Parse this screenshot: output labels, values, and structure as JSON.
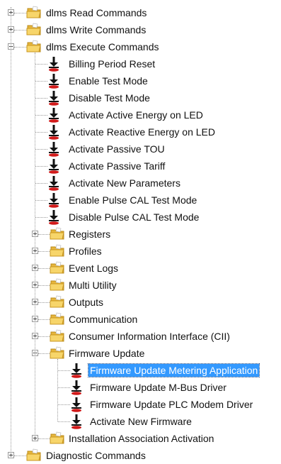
{
  "tree": {
    "top": [
      {
        "label": "dlms Read Commands",
        "state": "collapsed"
      },
      {
        "label": "dlms Write Commands",
        "state": "collapsed"
      },
      {
        "label": "dlms Execute Commands",
        "state": "expanded"
      }
    ],
    "execute_commands": [
      "Billing Period Reset",
      "Enable Test Mode",
      "Disable Test Mode",
      "Activate Active Energy on LED",
      "Activate Reactive Energy on LED",
      "Activate Passive TOU",
      "Activate Passive Tariff",
      "Activate New Parameters",
      "Enable Pulse CAL Test Mode",
      "Disable Pulse CAL Test Mode"
    ],
    "execute_folders": [
      "Registers",
      "Profiles",
      "Event Logs",
      "Multi Utility",
      "Outputs",
      "Communication",
      "Consumer Information Interface (CII)",
      "Firmware Update"
    ],
    "firmware_commands": [
      "Firmware Update Metering Application",
      "Firmware Update M-Bus Driver",
      "Firmware Update PLC Modem Driver",
      "Activate New Firmware"
    ],
    "selected": "Firmware Update Metering Application",
    "after_firmware": "Installation Association Activation",
    "diagnostic": "Diagnostic Commands"
  },
  "icons": {
    "folder": "folder-icon",
    "command": "execute-command-icon"
  },
  "colors": {
    "selection": "#3399ff",
    "folder": "#f2c84b",
    "command_arrow": "#111111",
    "command_base": "#d11a1a"
  }
}
